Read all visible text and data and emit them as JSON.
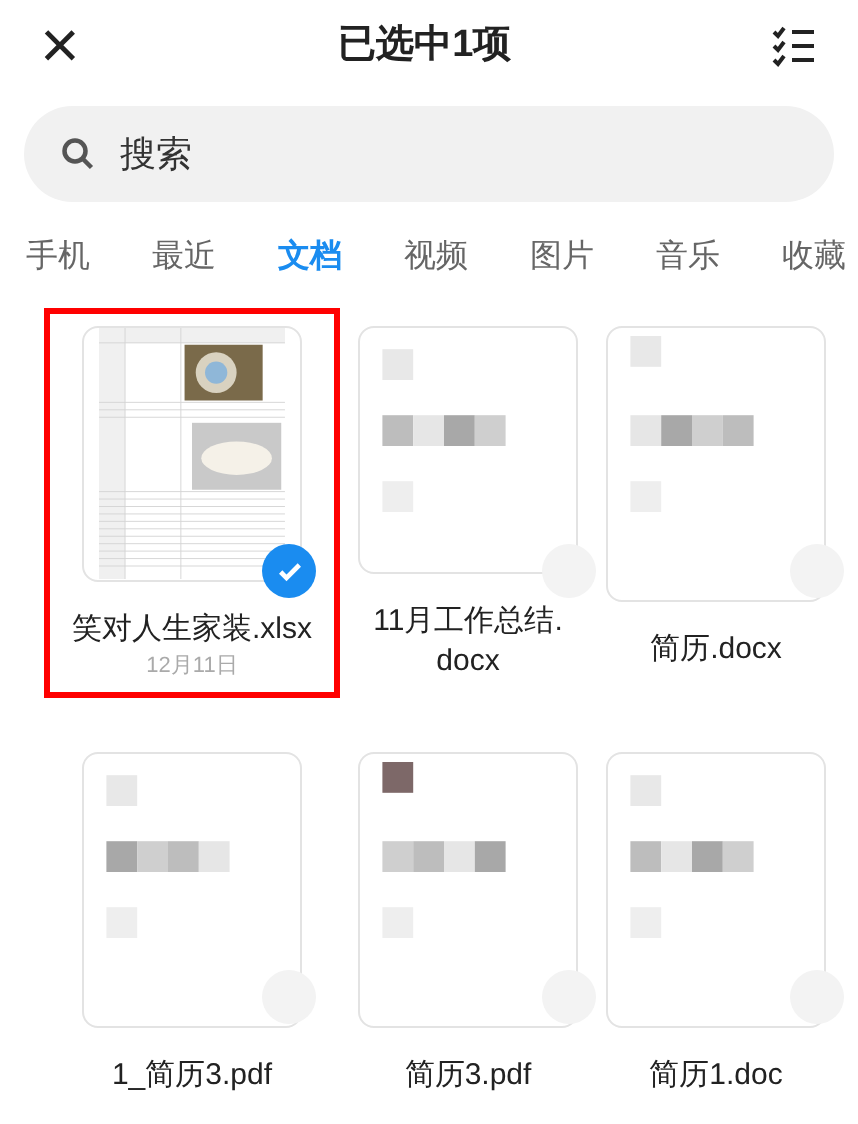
{
  "header": {
    "close": "×",
    "title": "已选中1项"
  },
  "search": {
    "placeholder": "搜索"
  },
  "tabs": [
    {
      "label": "手机",
      "selected": false
    },
    {
      "label": "最近",
      "selected": false
    },
    {
      "label": "文档",
      "selected": true
    },
    {
      "label": "视频",
      "selected": false
    },
    {
      "label": "图片",
      "selected": false
    },
    {
      "label": "音乐",
      "selected": false
    },
    {
      "label": "收藏",
      "selected": false
    }
  ],
  "files": [
    {
      "kind": "sheet",
      "name": "笑对人生家装.xlsx",
      "date": "12月11日",
      "selected": true
    },
    {
      "kind": "doc",
      "name": "11月工作总结.docx",
      "selected": false
    },
    {
      "kind": "doc",
      "name": "简历.docx",
      "selected": false
    },
    {
      "kind": "doc",
      "name": "1_简历3.pdf",
      "selected": false
    },
    {
      "kind": "doc",
      "name": "简历3.pdf",
      "selected": false
    },
    {
      "kind": "doc",
      "name": "简历1.doc",
      "selected": false
    }
  ]
}
